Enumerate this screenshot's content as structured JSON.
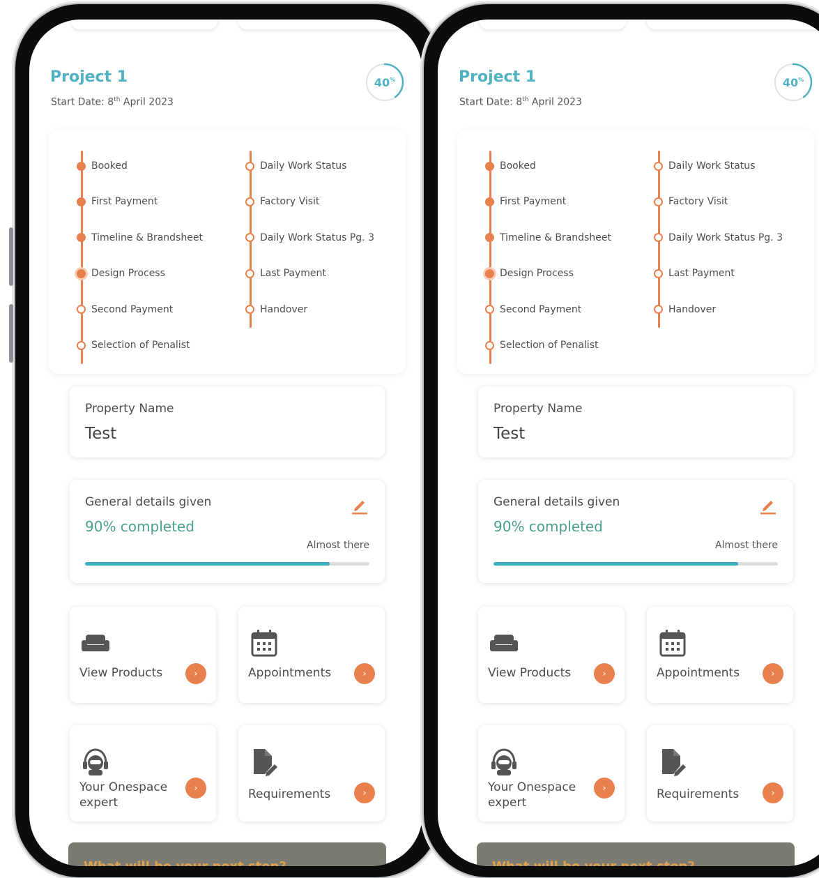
{
  "project": {
    "title": "Project 1",
    "start_label": "Start Date: 8",
    "start_suffix": "th",
    "start_rest": " April 2023",
    "progress_value": "40",
    "progress_unit": "%",
    "progress_fraction": 0.4
  },
  "timeline": {
    "left_steps": [
      {
        "label": "Booked",
        "state": "done"
      },
      {
        "label": "First Payment",
        "state": "done"
      },
      {
        "label": "Timeline & Brandsheet",
        "state": "done"
      },
      {
        "label": "Design Process",
        "state": "current"
      },
      {
        "label": "Second Payment",
        "state": "pending"
      },
      {
        "label": "Selection of Penalist",
        "state": "pending"
      }
    ],
    "right_steps": [
      {
        "label": "Daily Work Status",
        "state": "pending"
      },
      {
        "label": "Factory Visit",
        "state": "pending"
      },
      {
        "label": "Daily Work Status Pg. 3",
        "state": "pending"
      },
      {
        "label": "Last Payment",
        "state": "pending"
      },
      {
        "label": "Handover",
        "state": "pending"
      }
    ]
  },
  "property": {
    "label": "Property Name",
    "value": "Test"
  },
  "general": {
    "label": "General details given",
    "completed": "90% completed",
    "note": "Almost there",
    "progress_fraction": 0.86
  },
  "tiles": {
    "view_products": "View Products",
    "appointments": "Appointments",
    "expert_line1": "Your Onespace",
    "expert_line2": "expert",
    "requirements": "Requirements",
    "arrow_glyph": "›"
  },
  "next_step": {
    "label": "What will be your next step?"
  },
  "icons": [
    "sofa-icon",
    "calendar-icon",
    "support-agent-icon",
    "document-edit-icon",
    "edit-pencil-icon",
    "chevron-right-icon"
  ],
  "colors": {
    "teal": "#4fb1c1",
    "accent_orange": "#e8804e",
    "progress_bar": "#3eaec0",
    "success_text": "#4a9f8f"
  }
}
